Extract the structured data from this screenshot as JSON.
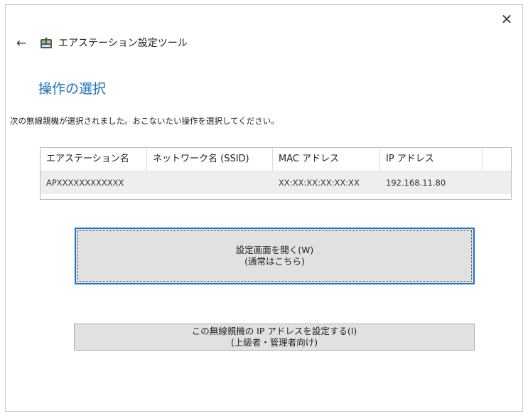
{
  "window": {
    "app_title": "エアステーション設定ツール",
    "close_icon": "close-icon",
    "back_icon": "back-arrow-icon",
    "app_icon": "air-station-icon"
  },
  "page": {
    "title": "操作の選択",
    "description": "次の無線親機が選択されました。おこないたい操作を選択してください。"
  },
  "table": {
    "headers": [
      "エアステーション名",
      "ネットワーク名 (SSID)",
      "MAC アドレス",
      "IP アドレス",
      ""
    ],
    "rows": [
      [
        "APXXXXXXXXXXXX",
        "",
        "XX:XX:XX:XX:XX:XX",
        "192.168.11.80",
        ""
      ]
    ]
  },
  "buttons": {
    "open_settings": {
      "line1": "設定画面を開く(W)",
      "line2": "(通常はこちら)"
    },
    "set_ip": {
      "line1": "この無線親機の IP アドレスを設定する(I)",
      "line2": "(上級者・管理者向け)"
    }
  }
}
